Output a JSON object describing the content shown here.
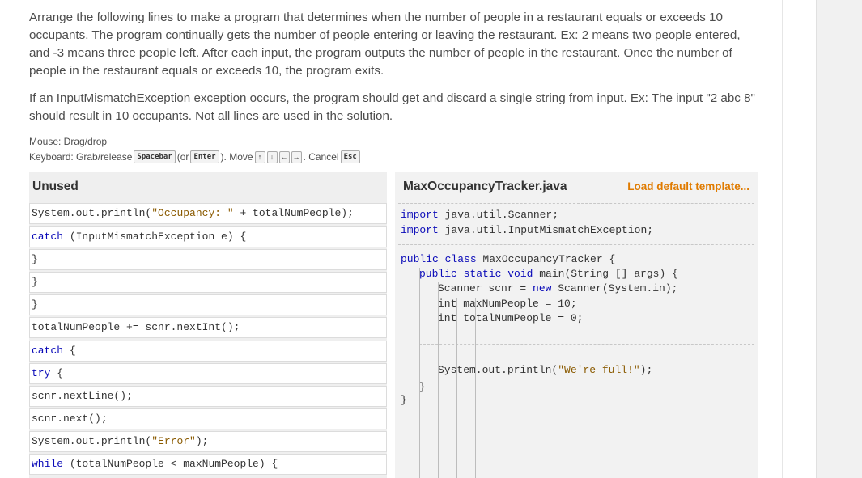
{
  "instructions": {
    "paragraph1": "Arrange the following lines to make a program that determines when the number of people in a restaurant equals or exceeds 10 occupants. The program continually gets the number of people entering or leaving the restaurant. Ex: 2 means two people entered, and -3 means three people left. After each input, the program outputs the number of people in the restaurant. Once the number of people in the restaurant equals or exceeds 10, the program exits.",
    "paragraph2": "If an InputMismatchException exception occurs, the program should get and discard a single string from input. Ex: The input \"2 abc 8\" should result in 10 occupants. Not all lines are used in the solution."
  },
  "help": {
    "mouse": "Mouse: Drag/drop",
    "keyboard_prefix": "Keyboard: Grab/release",
    "spacebar": "Spacebar",
    "or_open": "(or",
    "enter": "Enter",
    "close_move": "). Move",
    "arrows": [
      "↑",
      "↓",
      "←",
      "→"
    ],
    "cancel": ". Cancel",
    "esc": "Esc"
  },
  "unused": {
    "title": "Unused",
    "lines": [
      {
        "kw": "",
        "rest": "System.out.println(",
        "str": "\"Occupancy: \"",
        "tail": " + totalNumPeople);"
      },
      {
        "kw": "catch",
        "rest": " (InputMismatchException e) {",
        "str": "",
        "tail": ""
      },
      {
        "kw": "",
        "rest": "}",
        "str": "",
        "tail": ""
      },
      {
        "kw": "",
        "rest": "}",
        "str": "",
        "tail": ""
      },
      {
        "kw": "",
        "rest": "}",
        "str": "",
        "tail": ""
      },
      {
        "kw": "",
        "rest": "totalNumPeople += scnr.nextInt();",
        "str": "",
        "tail": ""
      },
      {
        "kw": "catch",
        "rest": " {",
        "str": "",
        "tail": ""
      },
      {
        "kw": "try",
        "rest": " {",
        "str": "",
        "tail": ""
      },
      {
        "kw": "",
        "rest": "scnr.nextLine();",
        "str": "",
        "tail": ""
      },
      {
        "kw": "",
        "rest": "scnr.next();",
        "str": "",
        "tail": ""
      },
      {
        "kw": "",
        "rest": "System.out.println(",
        "str": "\"Error\"",
        "tail": ");"
      },
      {
        "kw": "while",
        "rest": " (totalNumPeople < maxNumPeople) {",
        "str": "",
        "tail": ""
      }
    ]
  },
  "editor": {
    "filename": "MaxOccupancyTracker.java",
    "load_label": "Load default template...",
    "import1_kw": "import",
    "import1_rest": " java.util.Scanner;",
    "import2_kw": "import",
    "import2_rest": " java.util.InputMismatchException;",
    "class_kw": "public class",
    "class_rest": " MaxOccupancyTracker {",
    "main_kw": "public static void",
    "main_rest": " main(String [] args) {",
    "scanner_a": "Scanner scnr = ",
    "scanner_kw": "new",
    "scanner_b": " Scanner(System.in);",
    "max_kw": "int",
    "max_rest": " maxNumPeople = 10;",
    "total_kw": "int",
    "total_rest": " totalNumPeople = 0;",
    "full_a": "System.out.println(",
    "full_str": "\"We're full!\"",
    "full_b": ");",
    "close_main": "}",
    "close_class": "}"
  },
  "colors": {
    "keyword": "#0a0ab8",
    "string": "#8a5a00",
    "link": "#e07b00"
  }
}
